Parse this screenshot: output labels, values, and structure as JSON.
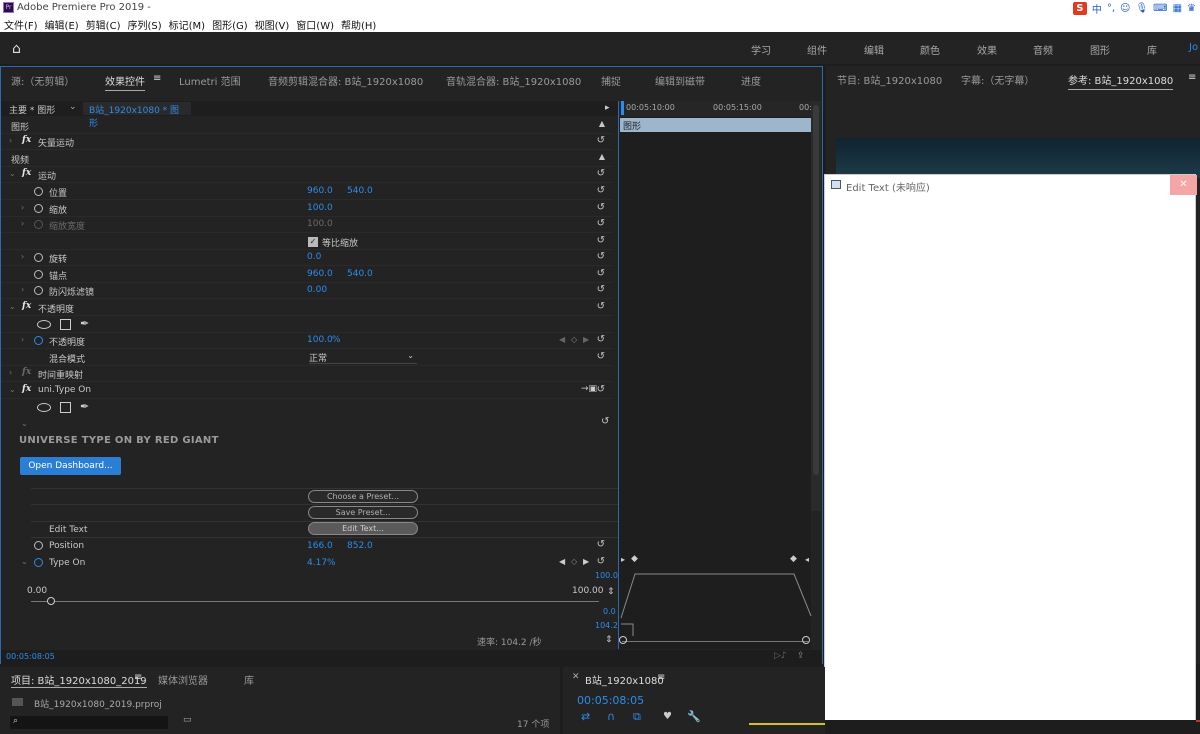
{
  "titlebar": {
    "title": "Adobe Premiere Pro 2019 -",
    "logo": "Pr",
    "tray_ime": "中",
    "tray_s": "S",
    "tray_dot": "°,"
  },
  "menu": [
    "文件(F)",
    "编辑(E)",
    "剪辑(C)",
    "序列(S)",
    "标记(M)",
    "图形(G)",
    "视图(V)",
    "窗口(W)",
    "帮助(H)"
  ],
  "workspaces": [
    "学习",
    "组件",
    "编辑",
    "颜色",
    "效果",
    "音频",
    "图形",
    "库",
    "Jo"
  ],
  "left_tabs": [
    "源:（无剪辑）",
    "效果控件",
    "Lumetri 范围",
    "音频剪辑混合器: B站_1920x1080",
    "音轨混合器: B站_1920x1080",
    "捕捉",
    "编辑到磁带",
    "进度"
  ],
  "active_tab_menu": "≡",
  "clip_header": {
    "master": "主要 * 图形",
    "sequence": "B站_1920x1080 * 图形"
  },
  "timeline_ruler": [
    "00:05:10:00",
    "00:05:15:00",
    "00:"
  ],
  "timeline_clip": "图形",
  "sections": {
    "graphics": "图形",
    "vector_motion": "矢量运动",
    "video": "视频"
  },
  "motion": {
    "name": "运动",
    "position_label": "位置",
    "position_x": "960.0",
    "position_y": "540.0",
    "scale_label": "缩放",
    "scale": "100.0",
    "scale_width_label": "缩放宽度",
    "scale_width": "100.0",
    "uniform_label": "等比缩放",
    "rotation_label": "旋转",
    "rotation": "0.0",
    "anchor_label": "锚点",
    "anchor_x": "960.0",
    "anchor_y": "540.0",
    "flicker_label": "防闪烁滤镜",
    "flicker": "0.00"
  },
  "opacity": {
    "name": "不透明度",
    "label": "不透明度",
    "value": "100.0",
    "unit": "%",
    "blend_label": "混合模式",
    "blend_value": "正常"
  },
  "time_remap": "时间重映射",
  "typeon": {
    "name": "uni.Type On",
    "brand": "UNIVERSE TYPE ON BY RED GIANT",
    "dashboard_button": "Open Dashboard...",
    "choose_preset": "Choose a Preset...",
    "save_preset": "Save Preset...",
    "edit_text_label": "Edit Text",
    "edit_text_button": "Edit Text...",
    "position_label": "Position",
    "position_x": "166.0",
    "position_y": "852.0",
    "typeon_label": "Type On",
    "typeon_value": "4.17",
    "typeon_unit": "%",
    "slider_min": "0.00",
    "slider_max": "100.00",
    "slider_fraction": 0.0,
    "graph_top": "100.0",
    "graph_bottom": "0.0",
    "speed_top": "104.2",
    "speed": "速率: 104.2 /秒"
  },
  "left_timecode": "00:05:08:05",
  "right_tabs": [
    "节目: B站_1920x1080",
    "字幕:（无字幕）",
    "参考: B站_1920x1080"
  ],
  "dialog": {
    "title": "Edit Text (未响应)",
    "close": "✕"
  },
  "project": {
    "tabs": [
      "项目: B站_1920x1080_2019",
      "媒体浏览器",
      "库"
    ],
    "file": "B站_1920x1080_2019.prproj",
    "search_placeholder": "",
    "count": "17 个项"
  },
  "sequence_panel": {
    "title": "B站_1920x1080",
    "timecode": "00:05:08:05"
  },
  "colors": {
    "accent": "#2d8ceb",
    "panel": "#232323",
    "bg": "#1d1d1d"
  }
}
